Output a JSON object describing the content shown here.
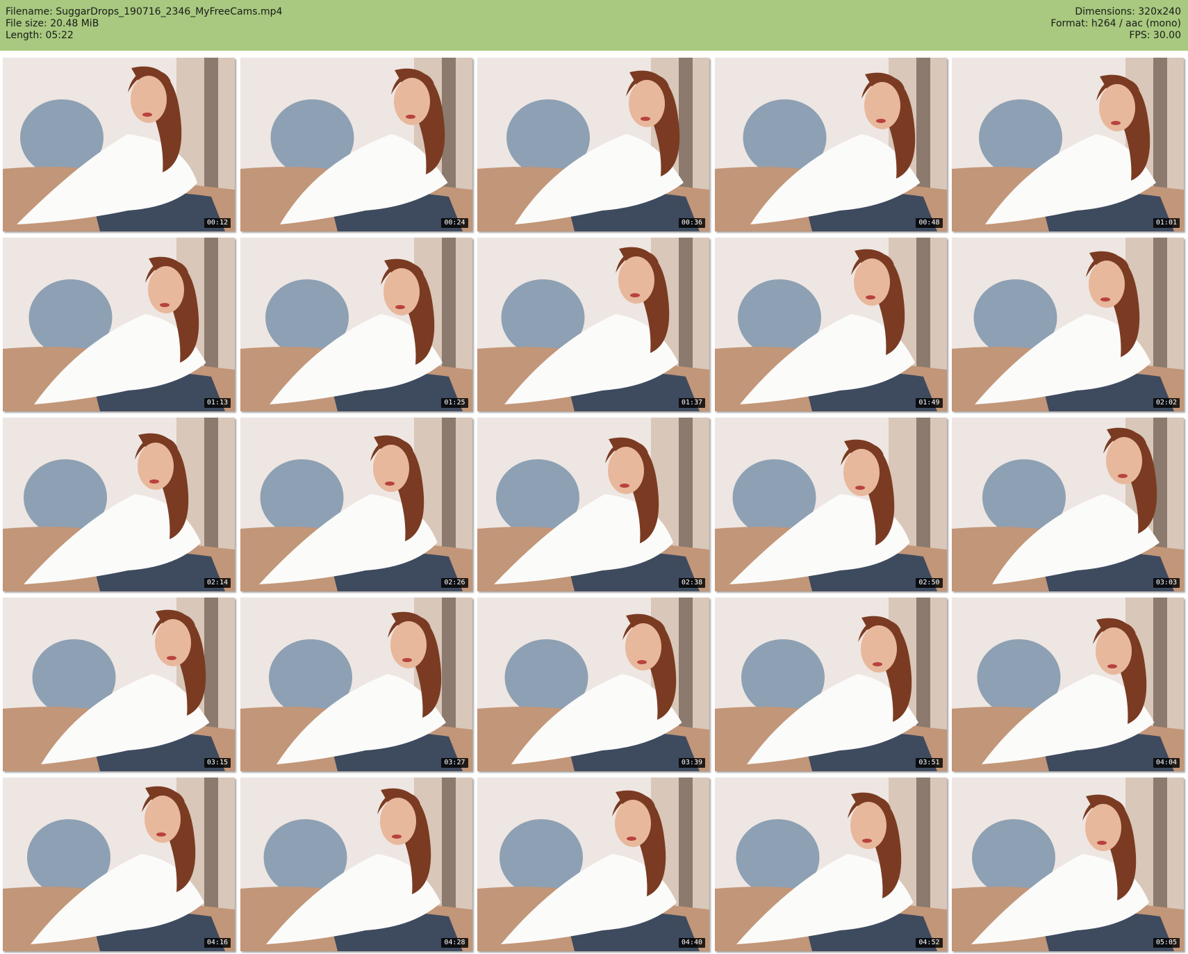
{
  "header": {
    "filename": "Filename: SuggarDrops_190716_2346_MyFreeCams.mp4",
    "file_size": "File size: 20.48 MiB",
    "length": "Length: 05:22",
    "dimensions": "Dimensions: 320x240",
    "format": "Format: h264 / aac (mono)",
    "fps": "FPS: 30.00"
  },
  "thumbnails": [
    {
      "time": "00:12"
    },
    {
      "time": "00:24"
    },
    {
      "time": "00:36"
    },
    {
      "time": "00:48"
    },
    {
      "time": "01:01"
    },
    {
      "time": "01:13"
    },
    {
      "time": "01:25"
    },
    {
      "time": "01:37"
    },
    {
      "time": "01:49"
    },
    {
      "time": "02:02"
    },
    {
      "time": "02:14"
    },
    {
      "time": "02:26"
    },
    {
      "time": "02:38"
    },
    {
      "time": "02:50"
    },
    {
      "time": "03:03"
    },
    {
      "time": "03:15"
    },
    {
      "time": "03:27"
    },
    {
      "time": "03:39"
    },
    {
      "time": "03:51"
    },
    {
      "time": "04:04"
    },
    {
      "time": "04:16"
    },
    {
      "time": "04:28"
    },
    {
      "time": "04:40"
    },
    {
      "time": "04:52"
    },
    {
      "time": "05:05"
    }
  ]
}
